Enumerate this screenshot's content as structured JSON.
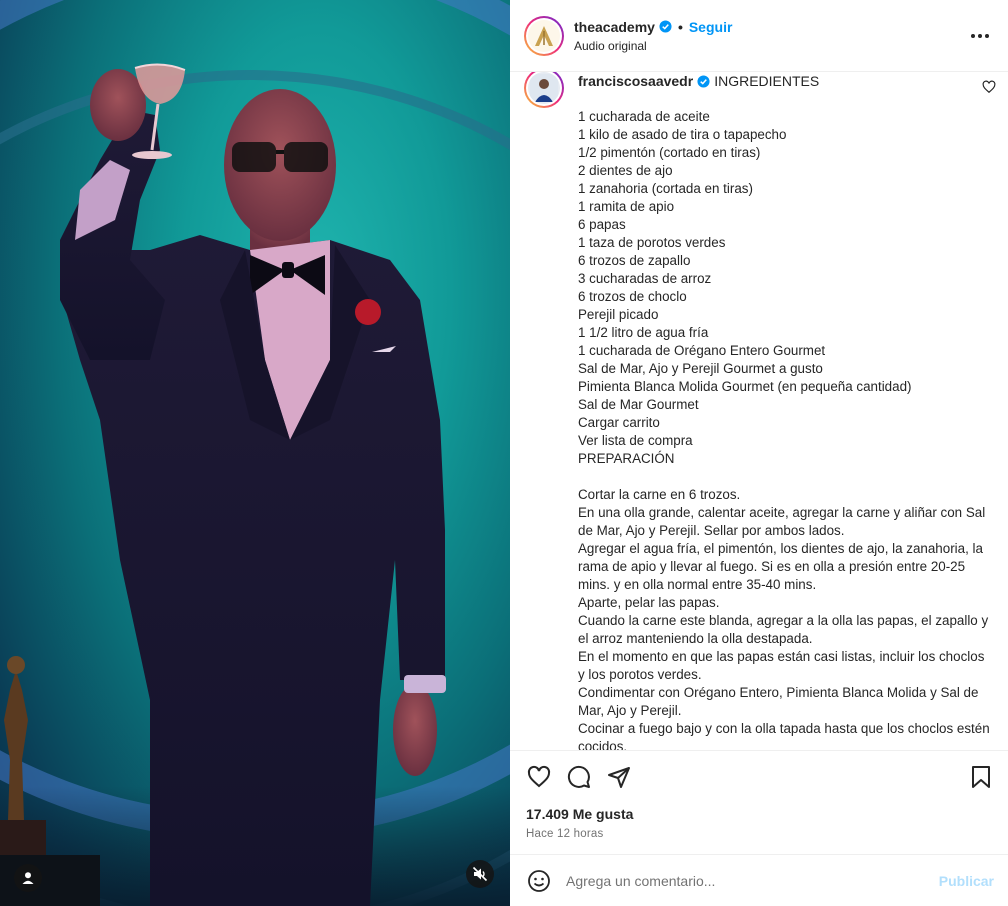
{
  "post": {
    "author": "theacademy",
    "follow_label": "Seguir",
    "separator": "•",
    "audio": "Audio original",
    "more_icon": "more-horizontal-icon"
  },
  "caption": {
    "author": "franciscosaavedr",
    "title": "INGREDIENTES",
    "ingredients": [
      "1 cucharada de aceite",
      "1 kilo de asado de tira o tapapecho",
      "1/2 pimentón (cortado en tiras)",
      "2 dientes de ajo",
      "1 zanahoria (cortada en tiras)",
      "1 ramita de apio",
      "6 papas",
      "1 taza de porotos verdes",
      "6 trozos de zapallo",
      "3 cucharadas de arroz",
      "6 trozos de choclo",
      "Perejil picado",
      "1 1/2 litro de agua fría",
      "1 cucharada de Orégano Entero Gourmet",
      "Sal de Mar, Ajo y Perejil Gourmet a gusto",
      "Pimienta Blanca Molida Gourmet (en pequeña cantidad)",
      "Sal de Mar Gourmet",
      "Cargar carrito",
      "Ver lista de compra",
      "PREPARACIÓN"
    ],
    "preparation": [
      "Cortar la carne en 6 trozos.",
      "En una olla grande, calentar aceite, agregar la carne y aliñar con Sal de Mar, Ajo y Perejil. Sellar por ambos lados.",
      "Agregar el agua fría, el pimentón, los dientes de ajo, la zanahoria, la rama de apio y llevar al fuego. Si es en olla a presión entre 20-25 mins. y en olla normal entre 35-40 mins.",
      "Aparte, pelar las papas.",
      "Cuando la carne este blanda, agregar a la olla las papas, el zapallo y el arroz manteniendo la olla destapada.",
      "En el momento en que las papas están casi listas, incluir los choclos y los porotos verdes.",
      "Condimentar con Orégano Entero, Pimienta Blanca Molida y Sal de Mar, Ajo y Perejil.",
      "Cocinar a fuego bajo y con la olla tapada hasta que los choclos estén cocidos."
    ]
  },
  "stats": {
    "likes": "17.409 Me gusta",
    "time": "Hace 12 horas"
  },
  "comment": {
    "placeholder": "Agrega un comentario...",
    "publish": "Publicar"
  },
  "colors": {
    "link_blue": "#0095f6",
    "publish_disabled": "#b2dffc",
    "verified_blue": "#0095f6"
  }
}
